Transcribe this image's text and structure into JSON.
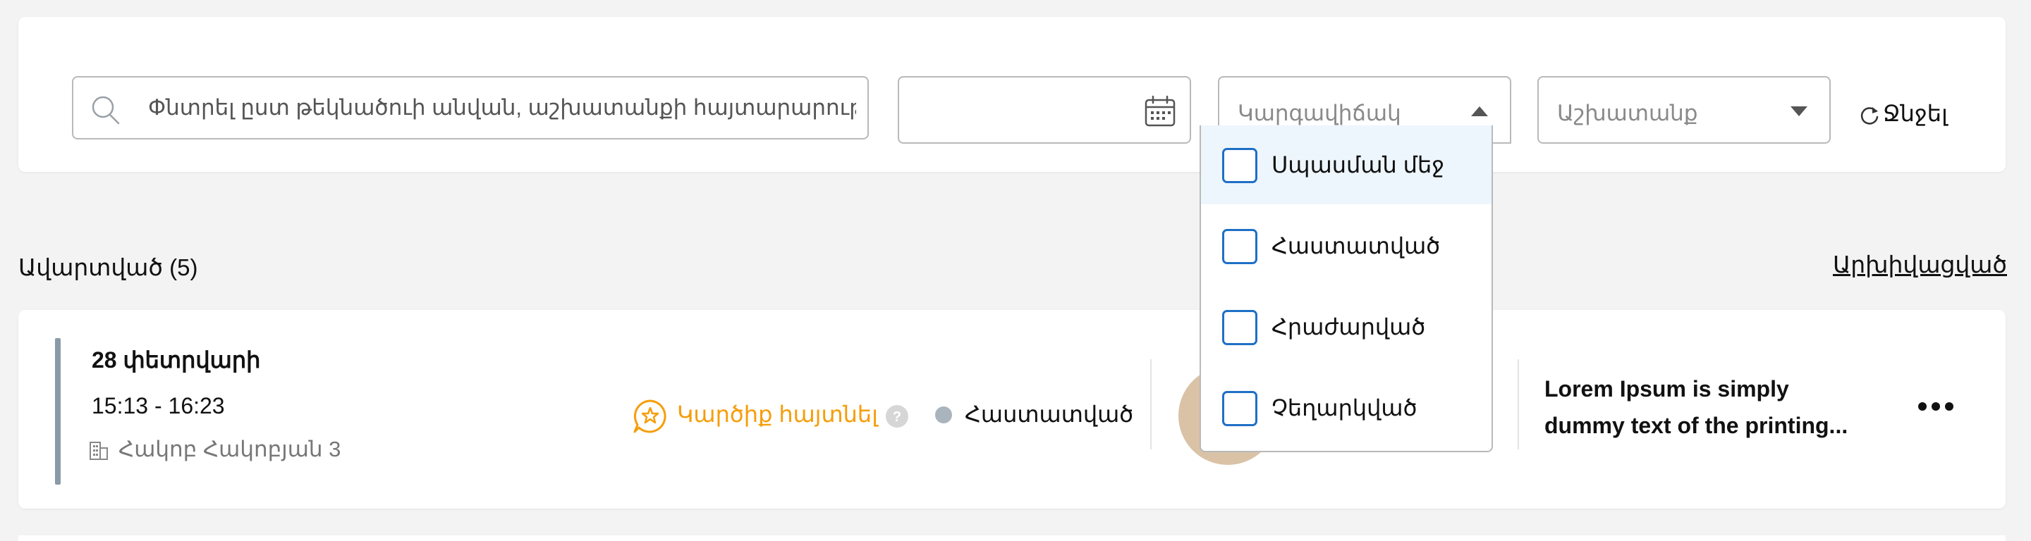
{
  "filters": {
    "search_placeholder": "Փնտրել ըստ թեկնածուի անվան, աշխատանքի հայտարարությա",
    "date_placeholder": "",
    "status_placeholder": "Կարգավիճակ",
    "job_placeholder": "Աշխատանք",
    "reset_label": "Ջնջել"
  },
  "status_dropdown": {
    "open": true,
    "options": [
      {
        "label": "Սպասման մեջ",
        "checked": false,
        "highlighted": true
      },
      {
        "label": "Հաստատված",
        "checked": false,
        "highlighted": false
      },
      {
        "label": "Հրաժարված",
        "checked": false,
        "highlighted": false
      },
      {
        "label": "Չեղարկված",
        "checked": false,
        "highlighted": false
      }
    ]
  },
  "section": {
    "title": "Ավարտված (5)",
    "archive_link": "Արխիվացված"
  },
  "interview_card": {
    "date": "28 փետրվարի",
    "time": "15:13 - 16:23",
    "address": "Հակոբ Հակոբյան 3",
    "review_label": "Կարծիք հայտնել",
    "status_label": "Հաստատված",
    "description_lines": [
      "Lorem Ipsum is simply",
      "dummy text of the printing..."
    ]
  },
  "colors": {
    "accent_blue": "#1f6fc6",
    "review_orange": "#f59e0b",
    "status_dot": "#a9b4bd",
    "highlight_bg": "#eef6fd"
  },
  "icons": [
    "search-icon",
    "calendar-icon",
    "chevron-up-icon",
    "chevron-down-icon",
    "refresh-icon",
    "building-icon",
    "star-chat-icon",
    "help-icon",
    "more-icon"
  ]
}
